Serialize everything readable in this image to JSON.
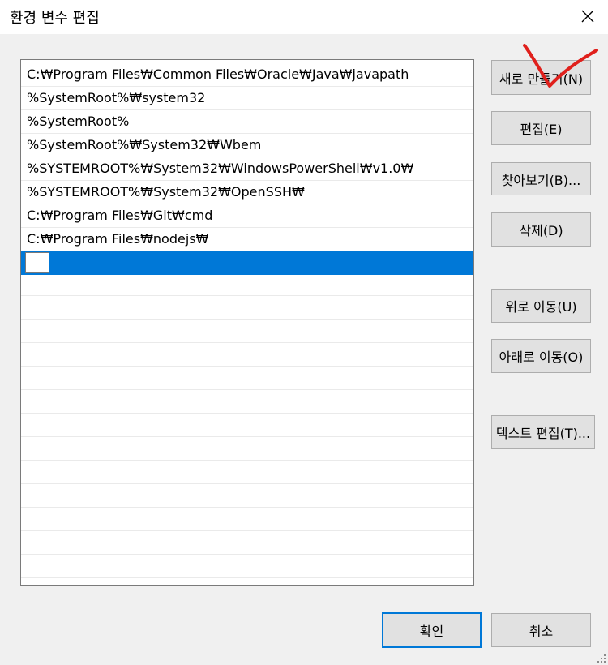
{
  "window": {
    "title": "환경 변수 편집"
  },
  "list": {
    "items": [
      "C:₩Program Files₩Common Files₩Oracle₩Java₩javapath",
      "%SystemRoot%₩system32",
      "%SystemRoot%",
      "%SystemRoot%₩System32₩Wbem",
      "%SYSTEMROOT%₩System32₩WindowsPowerShell₩v1.0₩",
      "%SYSTEMROOT%₩System32₩OpenSSH₩",
      "C:₩Program Files₩Git₩cmd",
      "C:₩Program Files₩nodejs₩",
      ""
    ],
    "selected_index": 8
  },
  "buttons": {
    "new": "새로 만들기(N)",
    "edit": "편집(E)",
    "browse": "찾아보기(B)...",
    "delete": "삭제(D)",
    "move_up": "위로 이동(U)",
    "move_down": "아래로 이동(O)",
    "edit_text": "텍스트 편집(T)...",
    "ok": "확인",
    "cancel": "취소"
  },
  "colors": {
    "selection": "#0078d7",
    "annotation": "#e0201c"
  },
  "icons": {
    "close": "close-icon",
    "annotation": "checkmark-annotation-icon",
    "resize": "resize-grip-icon"
  }
}
